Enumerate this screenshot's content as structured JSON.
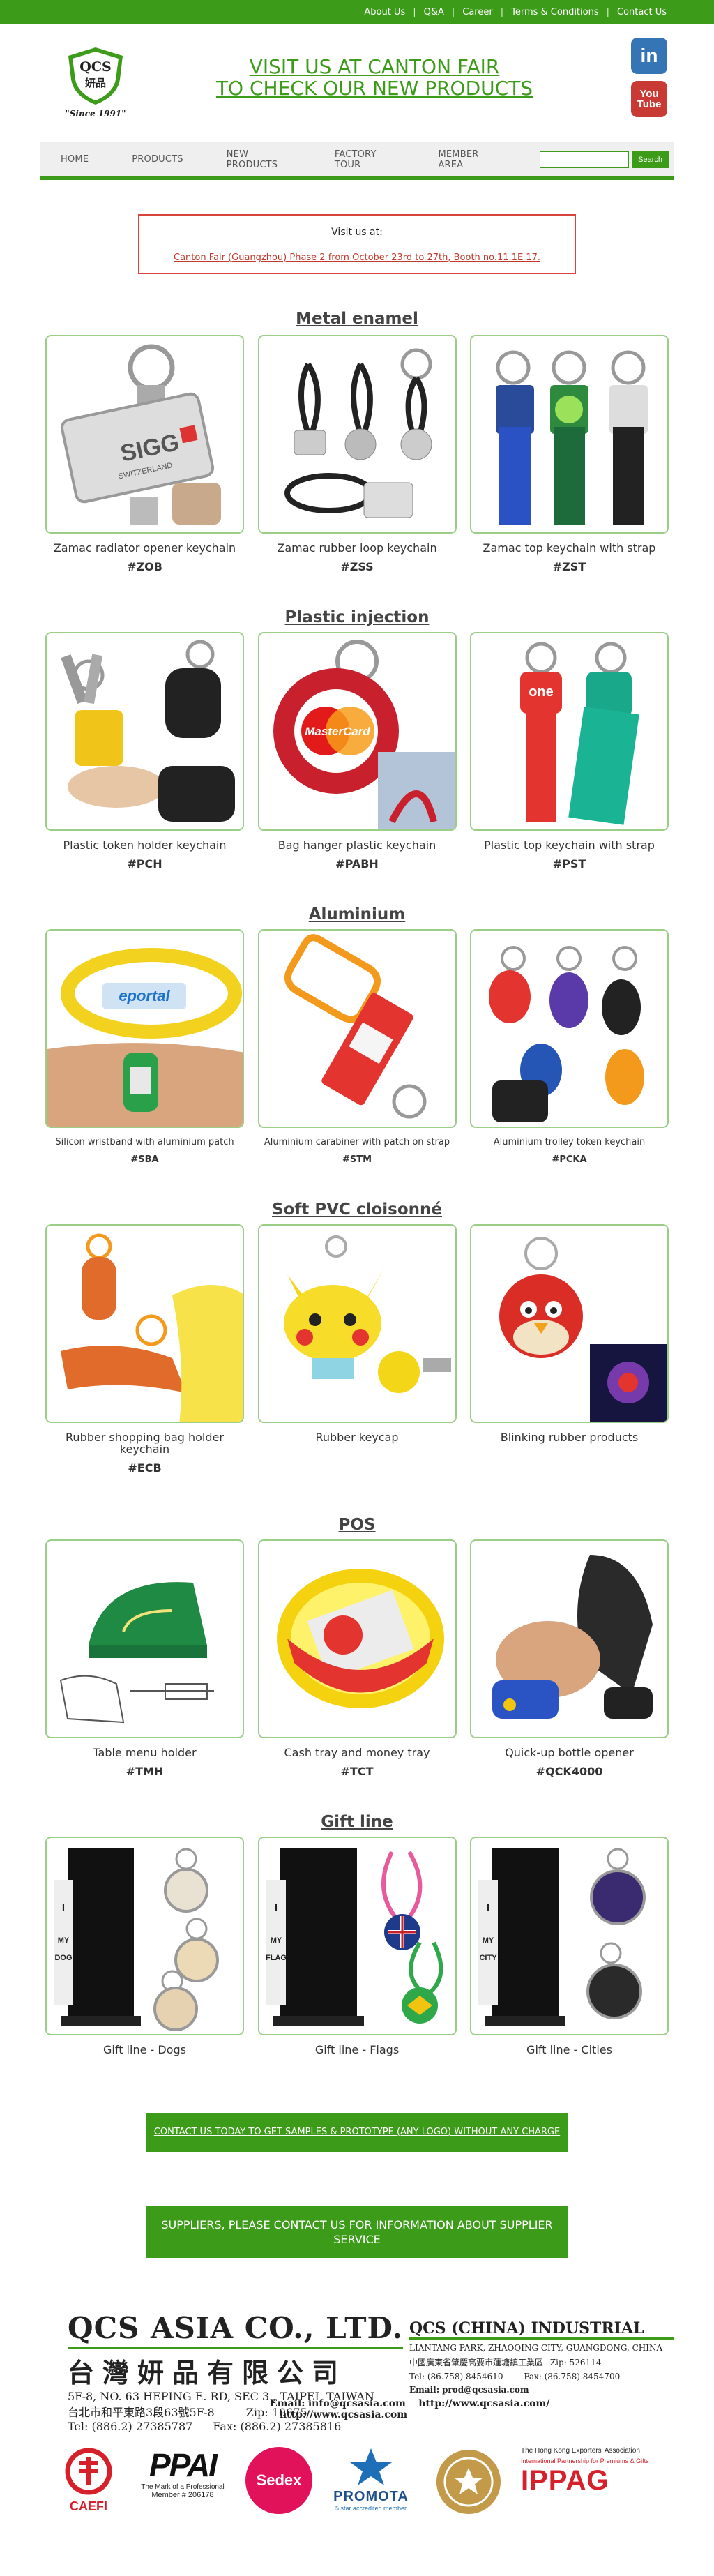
{
  "topbar": {
    "links": [
      "About Us",
      "Q&A",
      "Career",
      "Terms & Conditions",
      "Contact Us"
    ]
  },
  "header": {
    "logo_text_top": "QCS",
    "logo_text_cn": "妍品",
    "logo_since": "\"Since 1991\"",
    "headline_line1": "VISIT US AT CANTON FAIR",
    "headline_line2": "TO CHECK OUR NEW PRODUCTS",
    "linkedin_glyph": "in",
    "youtube_line1": "You",
    "youtube_line2": "Tube"
  },
  "nav": {
    "items": [
      "HOME",
      "PRODUCTS",
      "NEW PRODUCTS",
      "FACTORY TOUR",
      "MEMBER AREA"
    ],
    "search_placeholder": "",
    "search_button": "Search"
  },
  "visit": {
    "line1": "Visit us at:",
    "line2": "Canton Fair (Guangzhou) Phase 2 from October 23rd to 27th, Booth no.11.1E 17."
  },
  "sections": [
    {
      "title": "Metal enamel",
      "products": [
        {
          "name": "Zamac radiator opener keychain",
          "code": "#ZOB"
        },
        {
          "name": "Zamac rubber loop keychain",
          "code": "#ZSS"
        },
        {
          "name": "Zamac top keychain with strap",
          "code": "#ZST"
        }
      ]
    },
    {
      "title": "Plastic injection",
      "products": [
        {
          "name": "Plastic token holder keychain",
          "code": "#PCH"
        },
        {
          "name": "Bag hanger plastic keychain",
          "code": "#PABH"
        },
        {
          "name": "Plastic top keychain with strap",
          "code": "#PST"
        }
      ]
    },
    {
      "title": "Aluminium",
      "products": [
        {
          "name": "Silicon wristband with aluminium patch",
          "code": "#SBA"
        },
        {
          "name": "Aluminium carabiner with patch on strap",
          "code": "#STM"
        },
        {
          "name": "Aluminium trolley token keychain",
          "code": "#PCKA"
        }
      ]
    },
    {
      "title": "Soft PVC cloisonné",
      "products": [
        {
          "name": "Rubber shopping bag holder keychain",
          "code": "#ECB"
        },
        {
          "name": "Rubber keycap",
          "code": ""
        },
        {
          "name": "Blinking rubber products",
          "code": ""
        }
      ]
    },
    {
      "title": "POS",
      "products": [
        {
          "name": "Table menu holder",
          "code": "#TMH"
        },
        {
          "name": "Cash tray and money tray",
          "code": "#TCT"
        },
        {
          "name": "Quick-up bottle opener",
          "code": "#QCK4000"
        }
      ]
    },
    {
      "title": "Gift line",
      "products": [
        {
          "name": "Gift line - Dogs",
          "code": ""
        },
        {
          "name": "Gift line - Flags",
          "code": ""
        },
        {
          "name": "Gift line - Cities",
          "code": ""
        }
      ]
    }
  ],
  "image_text": {
    "sigg": "SIGG",
    "switzerland": "SWITZERLAND",
    "mastercard": "MasterCard",
    "eportal": "eportal",
    "one": "one",
    "i_love": "I",
    "my": "MY",
    "dog": "DOG",
    "flag": "FLAG",
    "city": "CITY"
  },
  "cta": {
    "samples": "CONTACT US TODAY TO GET SAMPLES & PROTOTYPE (ANY LOGO) WITHOUT ANY CHARGE",
    "suppliers": "SUPPLIERS, PLEASE CONTACT US FOR INFORMATION ABOUT SUPPLIER SERVICE"
  },
  "footer": {
    "company_en": "QCS ASIA CO., LTD.",
    "company_cn": "台灣妍品有限公司",
    "address_en": "5F-8, NO. 63 HEPING E. RD, SEC 3., TAIPEI, TAIWAN",
    "address_cn": "台北市和平東路3段63號5F-8",
    "zip": "Zip: 10675",
    "tel": "Tel: (886.2) 27385787",
    "fax": "Fax: (886.2) 27385816",
    "email_label": "Email:",
    "email": "info@qcsasia.com",
    "web": "http://www.qcsasia.com/",
    "china_company": "QCS (CHINA) INDUSTRIAL",
    "china_address": "LIANTANG PARK, ZHAOQING CITY, GUANGDONG, CHINA",
    "china_address_cn": "中國廣東省肇慶高要市蓮塘鎮工業區",
    "china_zip": "Zip: 526114",
    "china_tel": "Tel: (86.758) 8454610",
    "china_fax": "Fax: (86.758) 8454700",
    "china_email_label": "Email:",
    "china_email": "prod@qcsasia.com",
    "china_web": "http://www.qcsasia.com"
  },
  "member_logos": {
    "caefi": "CAEFI",
    "ppai": "PPAI",
    "ppai_sub": "The Mark of a Professional",
    "ppai_member": "Member # 206178",
    "sedex": "Sedex",
    "promota": "PROMOTA",
    "promota_sub": "5 star accredited member",
    "ipac": "IPPAG",
    "hkea": "The Hong Kong Exporters' Association",
    "ippag_sub": "International Partnership for Premiums & Gifts"
  },
  "colors": {
    "brand_green": "#3d9b1a",
    "card_border": "#9bcf87",
    "visit_border": "#d9443a"
  }
}
